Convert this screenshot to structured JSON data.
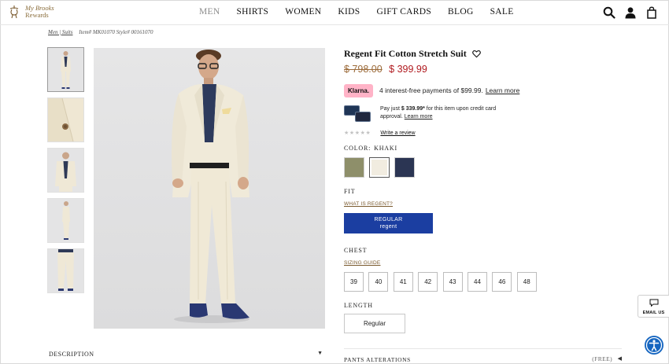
{
  "header": {
    "logo_line1": "My Brooks",
    "logo_line2": "Rewards",
    "nav": [
      "MEN",
      "SHIRTS",
      "WOMEN",
      "KIDS",
      "GIFT CARDS",
      "BLOG",
      "SALE"
    ],
    "active_nav": "MEN"
  },
  "breadcrumb": {
    "path": "Men | Suits",
    "sku": "Item# MK01070 Style# 00161070"
  },
  "product": {
    "title": "Regent Fit Cotton Stretch Suit",
    "price_original": "$ 798.00",
    "price_sale": "$ 399.99",
    "klarna": {
      "badge": "Klarna.",
      "text": "4 interest-free payments of $99.99.",
      "link": "Learn more"
    },
    "credit": {
      "text_pre": "Pay just ",
      "amount": "$ 339.99*",
      "text_post": " for this item upon credit card approval.",
      "link": "Learn more"
    },
    "rating_stars": "★★★★★",
    "review_link": "Write a review",
    "color": {
      "label": "COLOR:",
      "value": "KHAKI",
      "swatches": [
        {
          "name": "olive",
          "color": "#8e8f6a"
        },
        {
          "name": "khaki",
          "color": "#f1ece0"
        },
        {
          "name": "navy",
          "color": "#2b3553"
        }
      ]
    },
    "fit": {
      "label": "FIT",
      "helper": "WHAT IS REGENT?",
      "option_line1": "REGULAR",
      "option_line2": "regent"
    },
    "chest": {
      "label": "CHEST",
      "helper": "SIZING GUIDE",
      "sizes": [
        "39",
        "40",
        "41",
        "42",
        "43",
        "44",
        "46",
        "48"
      ]
    },
    "length": {
      "label": "LENGTH",
      "option": "Regular"
    },
    "alterations": {
      "label": "PANTS ALTERATIONS",
      "price": "(FREE)"
    }
  },
  "description_label": "DESCRIPTION",
  "email_us": "EMAIL US",
  "colors": {
    "accent_blue": "#1b3ea1",
    "sale_red": "#b0191e",
    "klarna_pink": "#ffb3c7"
  }
}
